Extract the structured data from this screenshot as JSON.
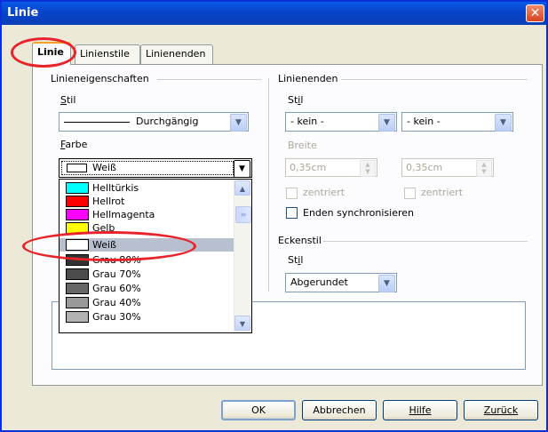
{
  "window": {
    "title": "Linie",
    "close_glyph": "✕"
  },
  "tabs": [
    {
      "label": "Linie",
      "active": true
    },
    {
      "label": "Linienstile",
      "active": false
    },
    {
      "label": "Linienenden",
      "active": false
    }
  ],
  "line_props": {
    "group_label": "Linieneigenschaften",
    "style_label": "Stil",
    "style_value": "Durchgängig",
    "color_label": "Farbe",
    "color_value": "Weiß",
    "color_value_swatch": "#ffffff"
  },
  "color_list": [
    {
      "name": "Helltürkis",
      "color": "#00ffff"
    },
    {
      "name": "Hellrot",
      "color": "#ff0000"
    },
    {
      "name": "Hellmagenta",
      "color": "#ff00ff"
    },
    {
      "name": "Gelb",
      "color": "#ffff00"
    },
    {
      "name": "Weiß",
      "color": "#ffffff",
      "selected": true
    },
    {
      "name": "Grau 80%",
      "color": "#333333"
    },
    {
      "name": "Grau 70%",
      "color": "#4c4c4c"
    },
    {
      "name": "Grau 60%",
      "color": "#666666"
    },
    {
      "name": "Grau 40%",
      "color": "#999999"
    },
    {
      "name": "Grau 30%",
      "color": "#b3b3b3"
    }
  ],
  "line_ends": {
    "group_label": "Linienenden",
    "style_label": "Stil",
    "start_value": "- kein -",
    "end_value": "- kein -",
    "width_label": "Breite",
    "start_width": "0,35cm",
    "end_width": "0,35cm",
    "center_start_label": "zentriert",
    "center_end_label": "zentriert",
    "sync_label": "Enden synchronisieren"
  },
  "corner": {
    "group_label": "Eckenstil",
    "style_label": "Stil",
    "style_value": "Abgerundet"
  },
  "buttons": {
    "ok": "OK",
    "cancel": "Abbrechen",
    "help": "Hilfe",
    "back": "Zurück"
  },
  "colors": {
    "annotation_red": "#e8232a",
    "titlebar_blue": "#0843c8"
  }
}
